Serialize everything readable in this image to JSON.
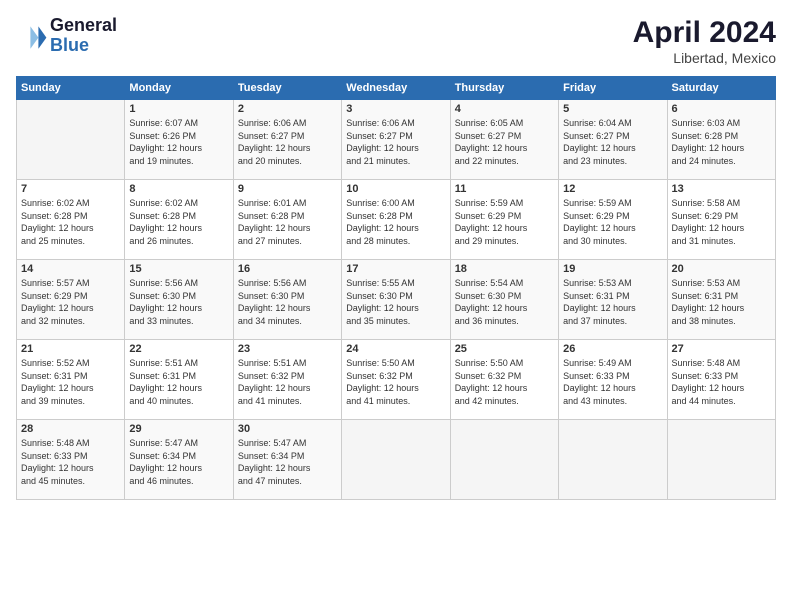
{
  "logo": {
    "line1": "General",
    "line2": "Blue"
  },
  "header": {
    "month": "April 2024",
    "location": "Libertad, Mexico"
  },
  "days_of_week": [
    "Sunday",
    "Monday",
    "Tuesday",
    "Wednesday",
    "Thursday",
    "Friday",
    "Saturday"
  ],
  "weeks": [
    [
      {
        "day": "",
        "info": ""
      },
      {
        "day": "1",
        "info": "Sunrise: 6:07 AM\nSunset: 6:26 PM\nDaylight: 12 hours\nand 19 minutes."
      },
      {
        "day": "2",
        "info": "Sunrise: 6:06 AM\nSunset: 6:27 PM\nDaylight: 12 hours\nand 20 minutes."
      },
      {
        "day": "3",
        "info": "Sunrise: 6:06 AM\nSunset: 6:27 PM\nDaylight: 12 hours\nand 21 minutes."
      },
      {
        "day": "4",
        "info": "Sunrise: 6:05 AM\nSunset: 6:27 PM\nDaylight: 12 hours\nand 22 minutes."
      },
      {
        "day": "5",
        "info": "Sunrise: 6:04 AM\nSunset: 6:27 PM\nDaylight: 12 hours\nand 23 minutes."
      },
      {
        "day": "6",
        "info": "Sunrise: 6:03 AM\nSunset: 6:28 PM\nDaylight: 12 hours\nand 24 minutes."
      }
    ],
    [
      {
        "day": "7",
        "info": "Sunrise: 6:02 AM\nSunset: 6:28 PM\nDaylight: 12 hours\nand 25 minutes."
      },
      {
        "day": "8",
        "info": "Sunrise: 6:02 AM\nSunset: 6:28 PM\nDaylight: 12 hours\nand 26 minutes."
      },
      {
        "day": "9",
        "info": "Sunrise: 6:01 AM\nSunset: 6:28 PM\nDaylight: 12 hours\nand 27 minutes."
      },
      {
        "day": "10",
        "info": "Sunrise: 6:00 AM\nSunset: 6:28 PM\nDaylight: 12 hours\nand 28 minutes."
      },
      {
        "day": "11",
        "info": "Sunrise: 5:59 AM\nSunset: 6:29 PM\nDaylight: 12 hours\nand 29 minutes."
      },
      {
        "day": "12",
        "info": "Sunrise: 5:59 AM\nSunset: 6:29 PM\nDaylight: 12 hours\nand 30 minutes."
      },
      {
        "day": "13",
        "info": "Sunrise: 5:58 AM\nSunset: 6:29 PM\nDaylight: 12 hours\nand 31 minutes."
      }
    ],
    [
      {
        "day": "14",
        "info": "Sunrise: 5:57 AM\nSunset: 6:29 PM\nDaylight: 12 hours\nand 32 minutes."
      },
      {
        "day": "15",
        "info": "Sunrise: 5:56 AM\nSunset: 6:30 PM\nDaylight: 12 hours\nand 33 minutes."
      },
      {
        "day": "16",
        "info": "Sunrise: 5:56 AM\nSunset: 6:30 PM\nDaylight: 12 hours\nand 34 minutes."
      },
      {
        "day": "17",
        "info": "Sunrise: 5:55 AM\nSunset: 6:30 PM\nDaylight: 12 hours\nand 35 minutes."
      },
      {
        "day": "18",
        "info": "Sunrise: 5:54 AM\nSunset: 6:30 PM\nDaylight: 12 hours\nand 36 minutes."
      },
      {
        "day": "19",
        "info": "Sunrise: 5:53 AM\nSunset: 6:31 PM\nDaylight: 12 hours\nand 37 minutes."
      },
      {
        "day": "20",
        "info": "Sunrise: 5:53 AM\nSunset: 6:31 PM\nDaylight: 12 hours\nand 38 minutes."
      }
    ],
    [
      {
        "day": "21",
        "info": "Sunrise: 5:52 AM\nSunset: 6:31 PM\nDaylight: 12 hours\nand 39 minutes."
      },
      {
        "day": "22",
        "info": "Sunrise: 5:51 AM\nSunset: 6:31 PM\nDaylight: 12 hours\nand 40 minutes."
      },
      {
        "day": "23",
        "info": "Sunrise: 5:51 AM\nSunset: 6:32 PM\nDaylight: 12 hours\nand 41 minutes."
      },
      {
        "day": "24",
        "info": "Sunrise: 5:50 AM\nSunset: 6:32 PM\nDaylight: 12 hours\nand 41 minutes."
      },
      {
        "day": "25",
        "info": "Sunrise: 5:50 AM\nSunset: 6:32 PM\nDaylight: 12 hours\nand 42 minutes."
      },
      {
        "day": "26",
        "info": "Sunrise: 5:49 AM\nSunset: 6:33 PM\nDaylight: 12 hours\nand 43 minutes."
      },
      {
        "day": "27",
        "info": "Sunrise: 5:48 AM\nSunset: 6:33 PM\nDaylight: 12 hours\nand 44 minutes."
      }
    ],
    [
      {
        "day": "28",
        "info": "Sunrise: 5:48 AM\nSunset: 6:33 PM\nDaylight: 12 hours\nand 45 minutes."
      },
      {
        "day": "29",
        "info": "Sunrise: 5:47 AM\nSunset: 6:34 PM\nDaylight: 12 hours\nand 46 minutes."
      },
      {
        "day": "30",
        "info": "Sunrise: 5:47 AM\nSunset: 6:34 PM\nDaylight: 12 hours\nand 47 minutes."
      },
      {
        "day": "",
        "info": ""
      },
      {
        "day": "",
        "info": ""
      },
      {
        "day": "",
        "info": ""
      },
      {
        "day": "",
        "info": ""
      }
    ]
  ]
}
